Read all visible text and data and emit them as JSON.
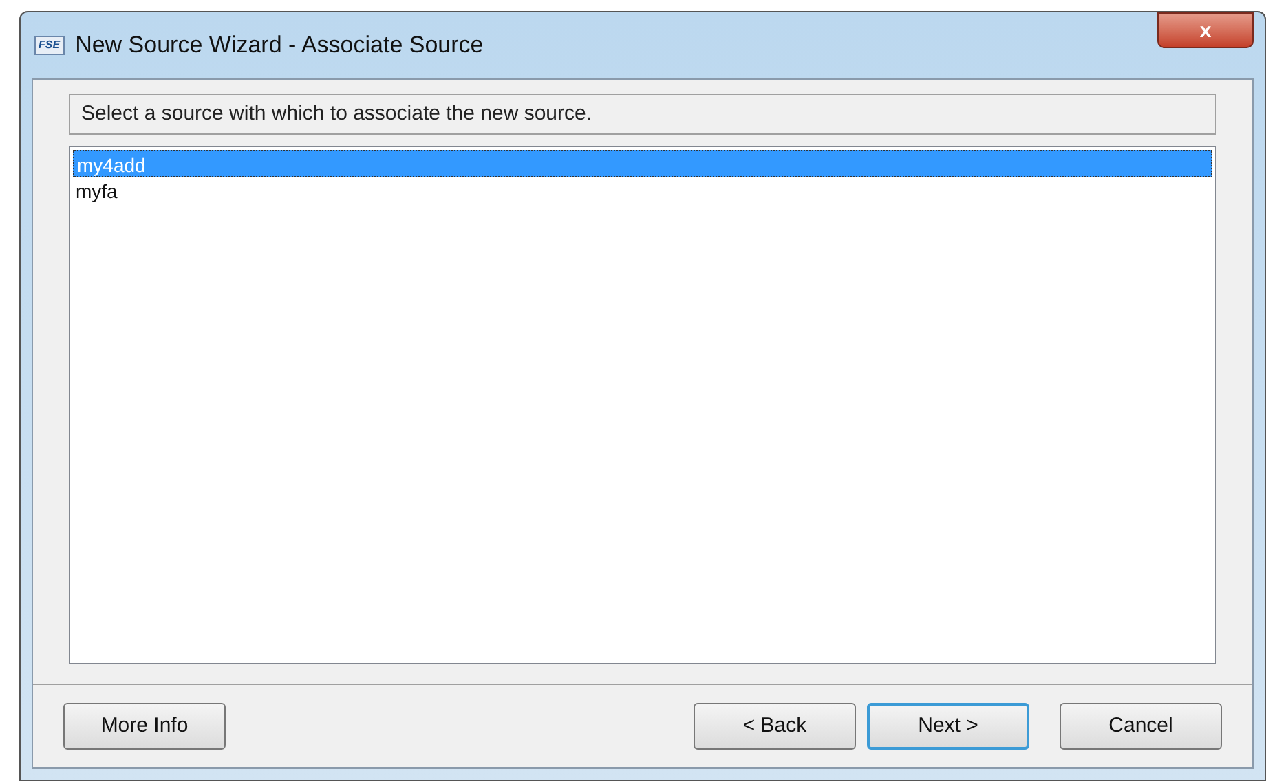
{
  "window": {
    "title": "New Source Wizard - Associate Source",
    "app_icon": "FSE",
    "close": "x"
  },
  "prompt": "Select a source with which to associate the new source.",
  "sources": [
    {
      "name": "my4add",
      "selected": true
    },
    {
      "name": "myfa",
      "selected": false
    }
  ],
  "buttons": [
    {
      "label": "More Info",
      "kind": "left",
      "selected": false
    },
    {
      "label": "< Back",
      "kind": "right",
      "selected": false
    },
    {
      "label": "Next >",
      "kind": "right",
      "selected": true
    },
    {
      "label": "Cancel",
      "kind": "right",
      "selected": false
    }
  ]
}
